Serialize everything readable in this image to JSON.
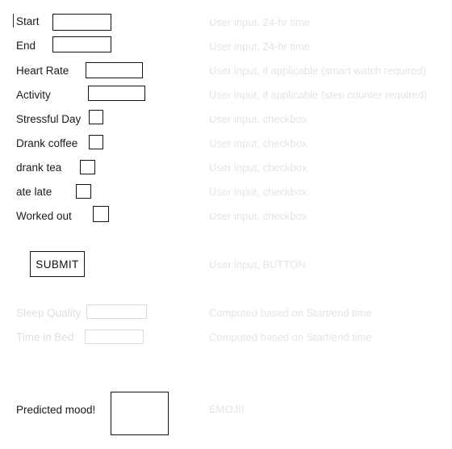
{
  "form": {
    "fields": [
      {
        "label": "Start",
        "annotation": "User input, 24-hr time"
      },
      {
        "label": "End",
        "annotation": "User input, 24-hr time"
      },
      {
        "label": "Heart Rate",
        "annotation": "User input, if applicable (smart watch required)"
      },
      {
        "label": "Activity",
        "annotation": "User input, if applicable (step counter required)"
      },
      {
        "label": "Stressful Day",
        "annotation": "User input, checkbox"
      },
      {
        "label": "Drank coffee",
        "annotation": "User input, checkbox"
      },
      {
        "label": "drank tea",
        "annotation": "User input, checkbox"
      },
      {
        "label": "ate late",
        "annotation": "User input, checkbox"
      },
      {
        "label": "Worked out",
        "annotation": "User input, checkbox"
      }
    ],
    "values": {
      "start": "",
      "end": "",
      "heart_rate": "",
      "activity": ""
    },
    "checkboxes": {
      "stressful_day": false,
      "drank_coffee": false,
      "drank_tea": false,
      "ate_late": false,
      "worked_out": false
    }
  },
  "submit": {
    "label": "SUBMIT",
    "annotation": "User input, BUTTON"
  },
  "computed": [
    {
      "label": "Sleep Quality",
      "value": "",
      "annotation": "Computed based on Start/end time"
    },
    {
      "label": "Time in Bed",
      "value": "",
      "annotation": "Computed based on Start/end time"
    }
  ],
  "result": {
    "label": "Predicted mood!",
    "value": "",
    "annotation": "EMOJI!"
  },
  "colors": {
    "ink": "#111111",
    "annotation_gray": "#e4e4e4",
    "muted_label_gray": "#dedede",
    "ghost_border": "#d9d9d9",
    "background": "#ffffff"
  }
}
